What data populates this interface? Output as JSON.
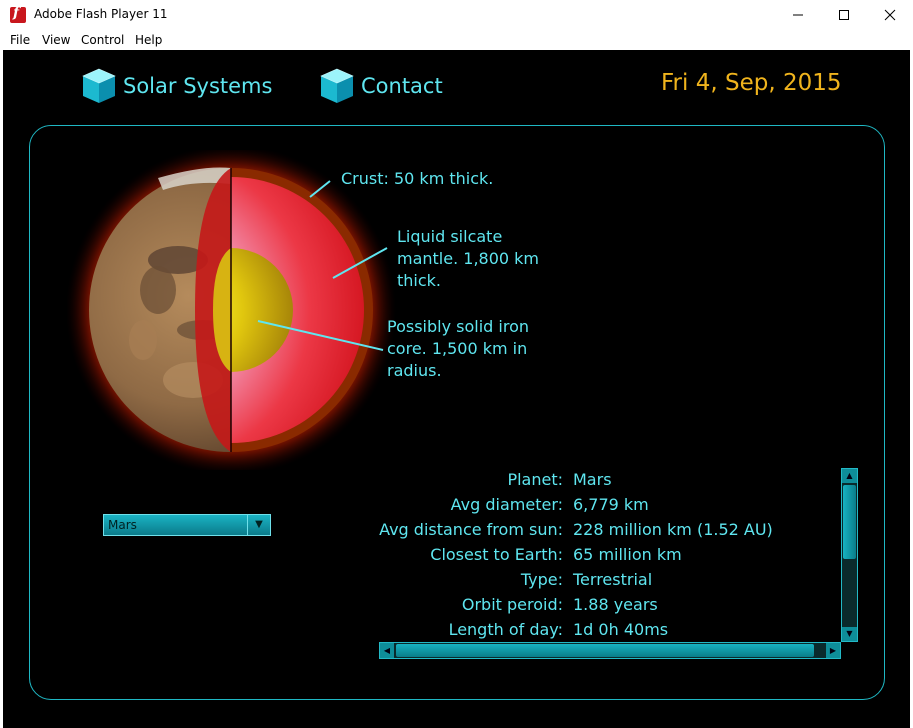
{
  "window": {
    "title": "Adobe Flash Player 11",
    "minimize_icon": "minimize-icon",
    "maximize_icon": "maximize-icon",
    "close_icon": "close-icon"
  },
  "menu": [
    "File",
    "View",
    "Control",
    "Help"
  ],
  "nav": {
    "items": [
      {
        "label": "Solar Systems",
        "icon": "cube-icon"
      },
      {
        "label": "Contact",
        "icon": "cube-icon"
      }
    ]
  },
  "date": "Fri 4, Sep, 2015",
  "diagram": {
    "labels": {
      "crust": "Crust: 50 km thick.",
      "mantle_1": "Liquid silcate",
      "mantle_2": "mantle. 1,800 km",
      "mantle_3": "thick.",
      "core_1": "Possibly solid iron",
      "core_2": "core. 1,500 km in",
      "core_3": "radius."
    }
  },
  "planet_select": {
    "value": "Mars"
  },
  "info": {
    "rows": [
      {
        "key": "Planet:",
        "value": "Mars"
      },
      {
        "key": "Avg diameter:",
        "value": "6,779 km"
      },
      {
        "key": "Avg distance from sun:",
        "value": "228 million km (1.52 AU)"
      },
      {
        "key": "Closest to Earth:",
        "value": "65 million km"
      },
      {
        "key": "Type:",
        "value": "Terrestrial"
      },
      {
        "key": "Orbit peroid:",
        "value": "1.88 years"
      },
      {
        "key": "Length of day:",
        "value": "1d 0h 40ms"
      }
    ]
  },
  "colors": {
    "accent": "#5fe6f0",
    "date": "#f0b41d",
    "background": "#000000"
  }
}
